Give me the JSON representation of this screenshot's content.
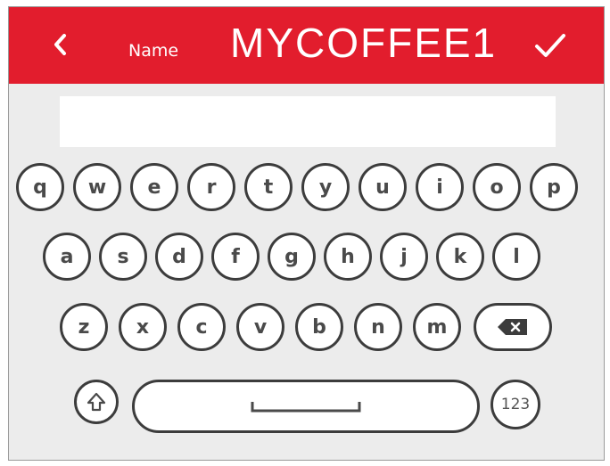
{
  "header": {
    "field_label": "Name",
    "value": "MYCOFFEE1",
    "back_icon": "chevron-left-icon",
    "confirm_icon": "checkmark-icon"
  },
  "input": {
    "value": "",
    "placeholder": ""
  },
  "keyboard": {
    "row1": [
      "q",
      "w",
      "e",
      "r",
      "t",
      "y",
      "u",
      "i",
      "o",
      "p"
    ],
    "row2": [
      "a",
      "s",
      "d",
      "f",
      "g",
      "h",
      "j",
      "k",
      "l"
    ],
    "row3": [
      "z",
      "x",
      "c",
      "v",
      "b",
      "n",
      "m"
    ],
    "backspace_icon": "backspace-icon",
    "shift_icon": "shift-icon",
    "space_icon": "space-bar-icon",
    "numbers_label": "123"
  },
  "colors": {
    "header": "#e21d2d",
    "background": "#ececec",
    "key_border": "#3c3c3c"
  }
}
